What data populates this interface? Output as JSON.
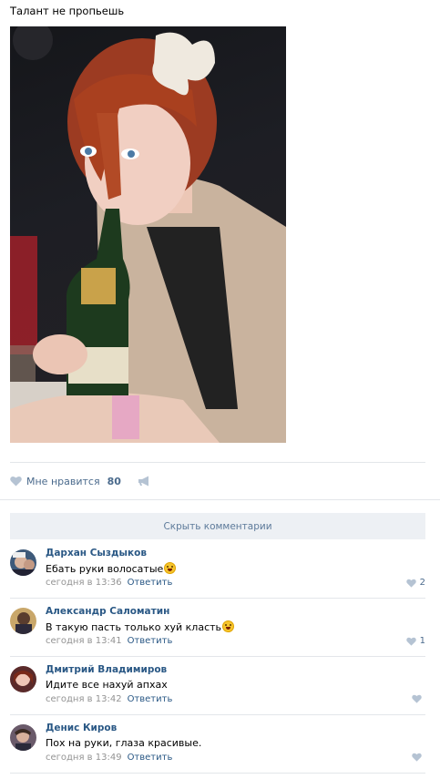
{
  "post": {
    "text": "Талант не пропьешь",
    "photo_icon": "photo-image"
  },
  "actions": {
    "like_label": "Мне нравится",
    "like_count": "80",
    "like_icon": "heart-icon",
    "share_icon": "megaphone-icon"
  },
  "hide_comments_label": "Скрыть комментарии",
  "colors": {
    "link": "#2a5885",
    "meta": "#939393",
    "button_bg": "#edf0f4",
    "divider": "#e3e6ea"
  },
  "comments": [
    {
      "author": "Дархан Сыздыков",
      "text": "Ебать руки волосатые",
      "emoji": true,
      "time": "сегодня в 13:36",
      "reply": "Ответить",
      "likes": "2"
    },
    {
      "author": "Александр Саломатин",
      "text": "В такую пасть только хуй класть",
      "emoji": true,
      "time": "сегодня в 13:41",
      "reply": "Ответить",
      "likes": "1"
    },
    {
      "author": "Дмитрий Владимиров",
      "text": "Идите все нахуй апхах",
      "emoji": false,
      "time": "сегодня в 13:42",
      "reply": "Ответить",
      "likes": ""
    },
    {
      "author": "Денис Киров",
      "text": "Пох на руки, глаза красивые.",
      "emoji": false,
      "time": "сегодня в 13:49",
      "reply": "Ответить",
      "likes": ""
    }
  ]
}
